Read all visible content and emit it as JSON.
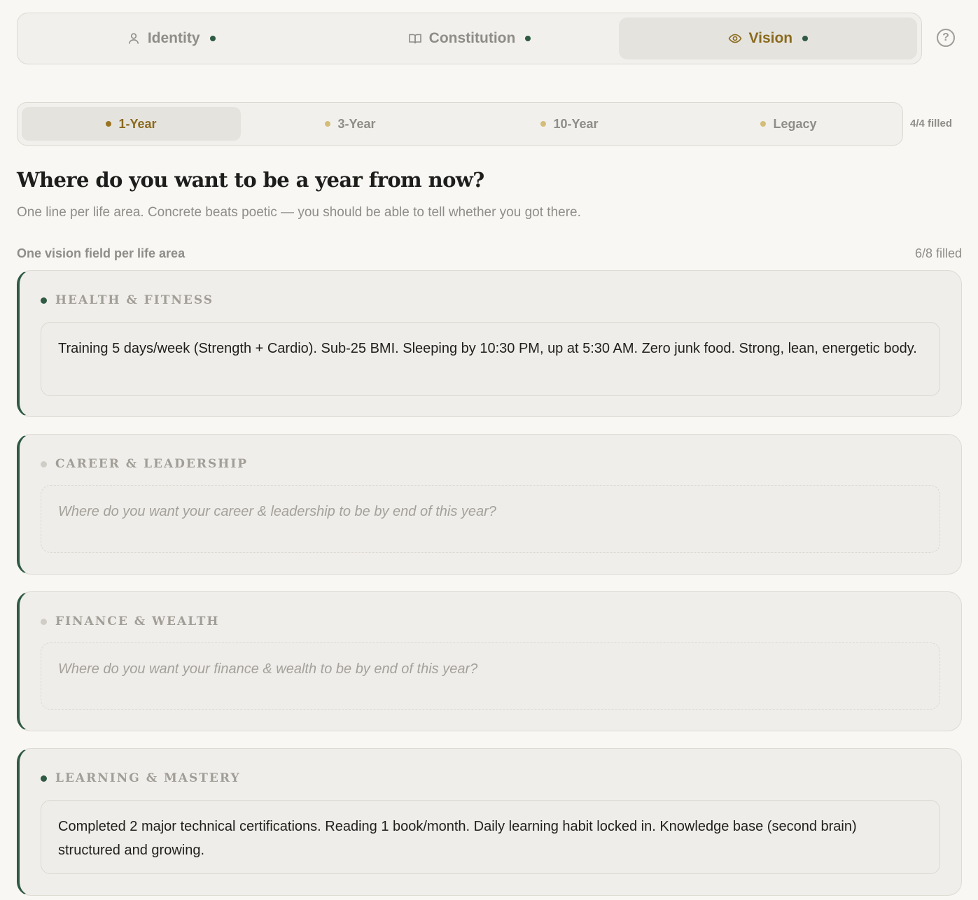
{
  "main_tabs": [
    {
      "label": "Identity",
      "icon": "user-icon",
      "active": false
    },
    {
      "label": "Constitution",
      "icon": "book-icon",
      "active": false
    },
    {
      "label": "Vision",
      "icon": "eye-icon",
      "active": true
    }
  ],
  "help": {
    "label": "?"
  },
  "horizon_tabs": [
    {
      "label": "1-Year",
      "active": true
    },
    {
      "label": "3-Year",
      "active": false
    },
    {
      "label": "10-Year",
      "active": false
    },
    {
      "label": "Legacy",
      "active": false
    }
  ],
  "horizon_count": "4/4 filled",
  "heading": {
    "title": "Where do you want to be a year from now?",
    "subtitle": "One line per life area. Concrete beats poetic — you should be able to tell whether you got there."
  },
  "section": {
    "label": "One vision field per life area",
    "count": "6/8 filled"
  },
  "cards": [
    {
      "title": "Health & Fitness",
      "value": "Training 5 days/week (Strength + Cardio). Sub-25 BMI. Sleeping by 10:30 PM, up at 5:30 AM. Zero junk food. Strong, lean, energetic body.",
      "placeholder": ""
    },
    {
      "title": "Career & Leadership",
      "value": "",
      "placeholder": "Where do you want your career & leadership to be by end of this year?"
    },
    {
      "title": "Finance & Wealth",
      "value": "",
      "placeholder": "Where do you want your finance & wealth to be by end of this year?"
    },
    {
      "title": "Learning & Mastery",
      "value": "Completed 2 major technical certifications. Reading 1 book/month. Daily learning habit locked in. Knowledge base (second brain) structured and growing.",
      "placeholder": ""
    }
  ],
  "colors": {
    "accent_gold": "#8a6a1e",
    "accent_green": "#2f5a43",
    "muted": "#8f8d87",
    "background": "#f8f7f4"
  }
}
